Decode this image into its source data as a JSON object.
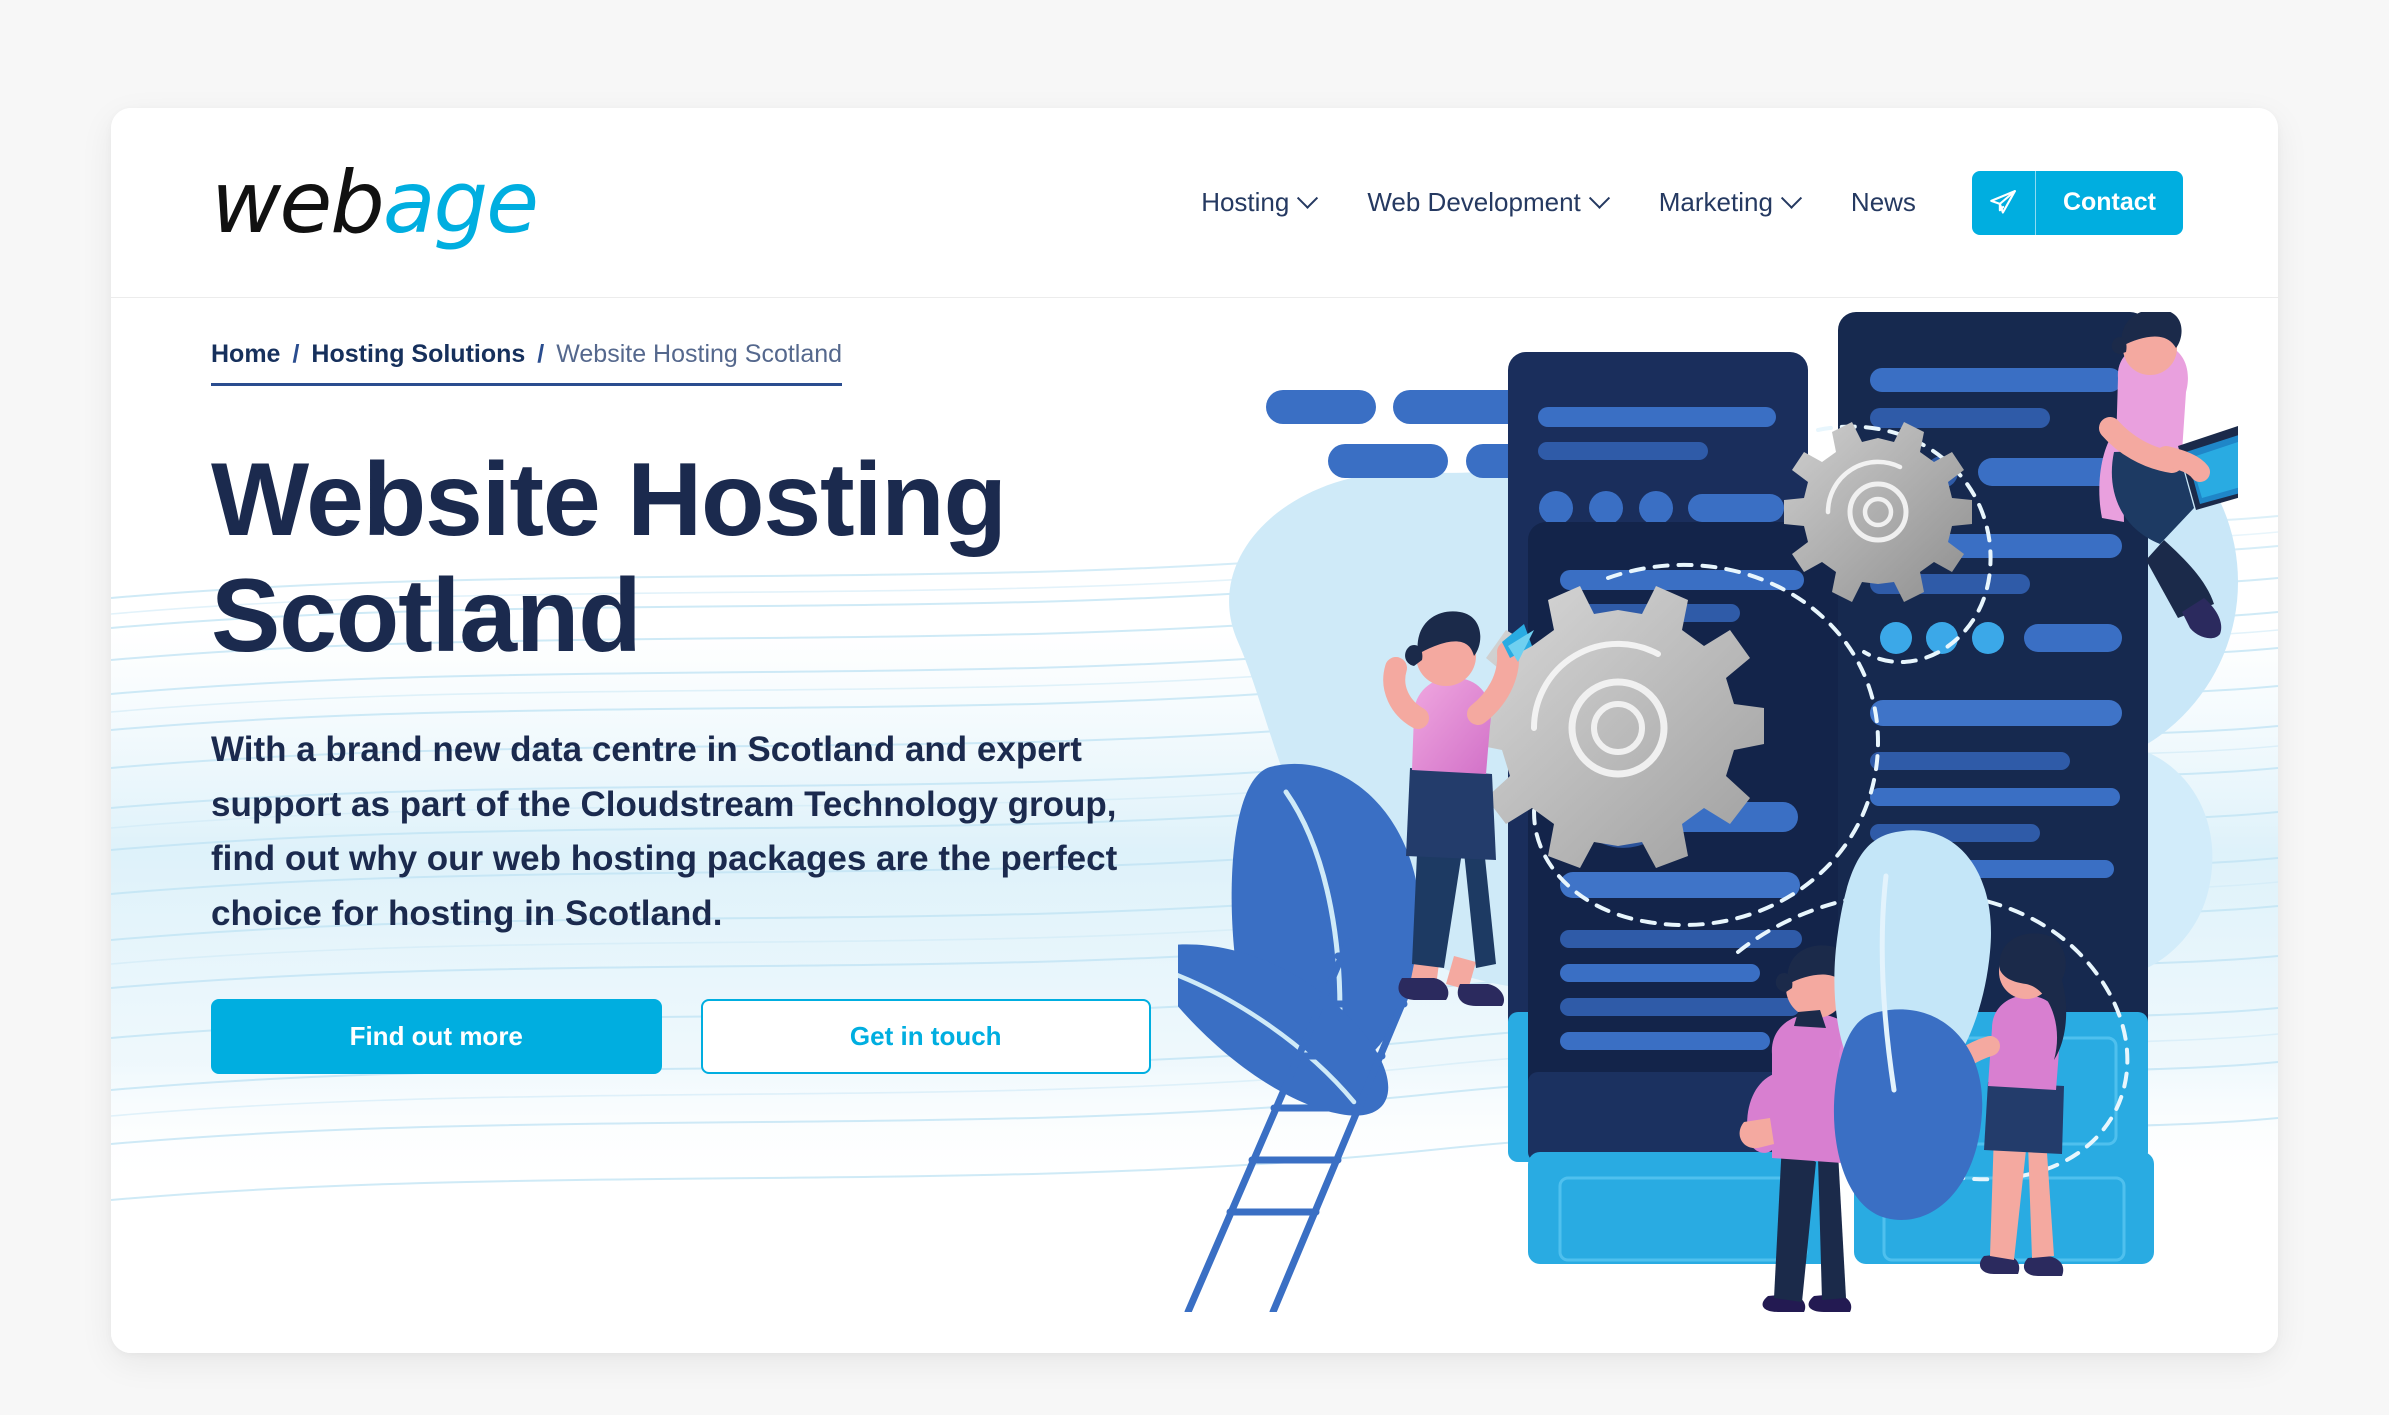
{
  "brand": {
    "logo_web": "web",
    "logo_age": "age",
    "accent_color": "#00AEE0",
    "navy_color": "#1B2A4E"
  },
  "header": {
    "nav_items": [
      {
        "label": "Hosting",
        "has_dropdown": true
      },
      {
        "label": "Web Development",
        "has_dropdown": true
      },
      {
        "label": "Marketing",
        "has_dropdown": true
      },
      {
        "label": "News",
        "has_dropdown": false
      }
    ],
    "contact_button": {
      "label": "Contact",
      "icon": "paper-plane-icon"
    }
  },
  "breadcrumb": {
    "items": [
      {
        "label": "Home",
        "current": false
      },
      {
        "label": "Hosting Solutions",
        "current": false
      },
      {
        "label": "Website Hosting Scotland",
        "current": true
      }
    ],
    "separator": "/"
  },
  "hero": {
    "title": "Website Hosting Scotland",
    "body": "With a brand new data centre in Scotland and expert support as part of the Cloudstream Technology group, find out why our web hosting packages are the perfect choice for hosting in Scotland.",
    "primary_button": "Find out more",
    "secondary_button": "Get in touch",
    "illustration_alt": "Illustration of people working on cloud server racks with gears, a ladder and dashed connection lines"
  }
}
